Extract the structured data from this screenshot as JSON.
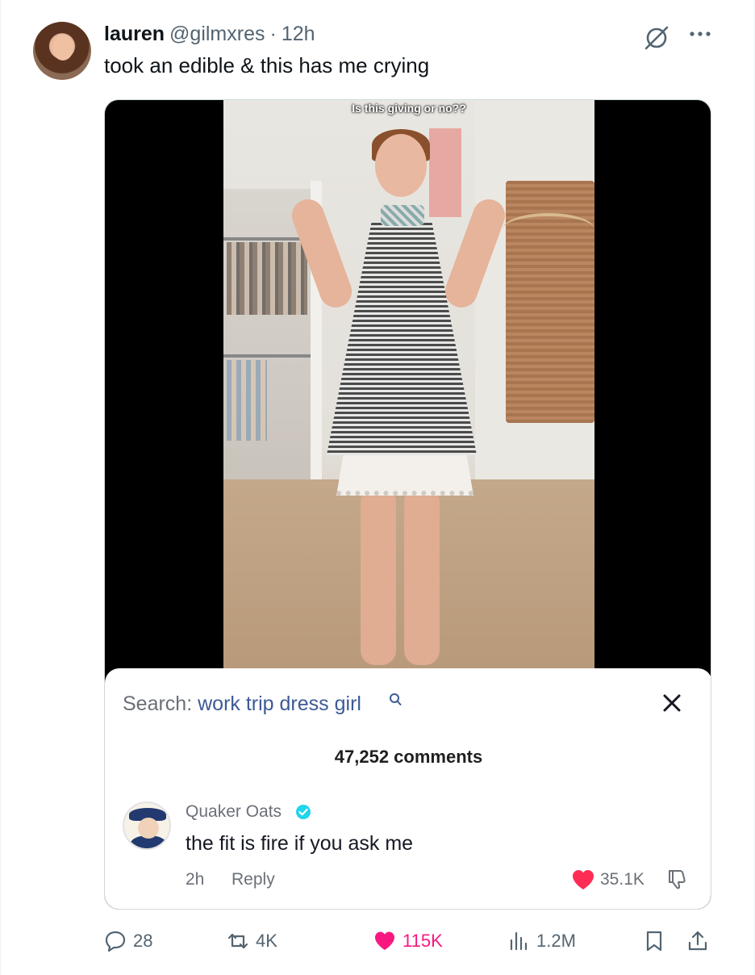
{
  "tweet": {
    "display_name": "lauren",
    "handle": "@gilmxres",
    "separator": "·",
    "time": "12h",
    "text": "took an edible & this has me crying"
  },
  "video": {
    "caption": "Is this giving or no??"
  },
  "comments_card": {
    "search_label": "Search:",
    "search_query": "work trip dress girl",
    "comment_count": "47,252 comments",
    "comment": {
      "author": "Quaker Oats",
      "verified": true,
      "text": "the fit is fire if you ask me",
      "time": "2h",
      "reply_label": "Reply",
      "likes": "35.1K"
    }
  },
  "actions": {
    "replies": "28",
    "reposts": "4K",
    "likes": "115K",
    "views": "1.2M"
  },
  "colors": {
    "like_pink": "#f91880",
    "search_query_blue": "#3d5a96",
    "muted_gray": "#536471",
    "verified_blue": "#20d5ec",
    "heart_red": "#fe2c55"
  }
}
